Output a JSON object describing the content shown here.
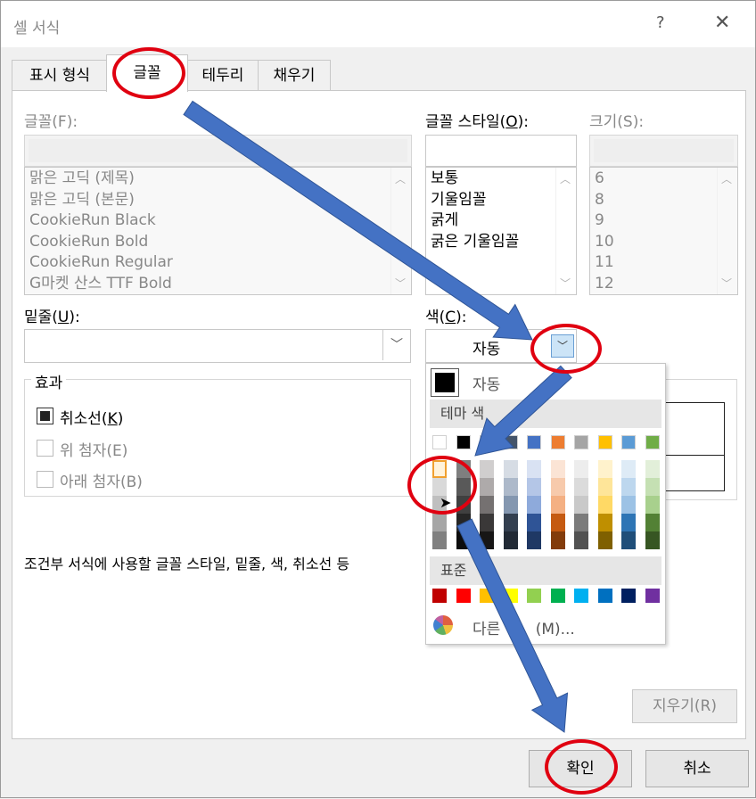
{
  "window": {
    "title": "셀 서식",
    "help": "?",
    "close": "✕"
  },
  "tabs": [
    {
      "label": "표시 형식"
    },
    {
      "label": "글꼴"
    },
    {
      "label": "테두리"
    },
    {
      "label": "채우기"
    }
  ],
  "font": {
    "label": "글꼴(F):",
    "items": [
      "맑은 고딕 (제목)",
      "맑은 고딕 (본문)",
      "CookieRun Black",
      "CookieRun Bold",
      "CookieRun Regular",
      "G마켓 산스 TTF Bold"
    ]
  },
  "style": {
    "label_pre": "글꼴 스타일(",
    "label_key": "O",
    "label_post": "):",
    "items": [
      "보통",
      "기울임꼴",
      "굵게",
      "굵은 기울임꼴"
    ]
  },
  "size": {
    "label": "크기(S):",
    "items": [
      "6",
      "8",
      "9",
      "10",
      "11",
      "12"
    ]
  },
  "underline": {
    "label_pre": "밑줄(",
    "label_key": "U",
    "label_post": "):",
    "value": ""
  },
  "color": {
    "label_pre": "색(",
    "label_key": "C",
    "label_post": "):",
    "value": "자동"
  },
  "effects": {
    "title": "효과",
    "strike_pre": "취소선(",
    "strike_key": "K",
    "strike_post": ")",
    "superscript": "위 첨자(E)",
    "subscript": "아래 첨자(B)"
  },
  "info_text": "조건부 서식에 사용할 글꼴 스타일, 밑줄, 색, 취소선 등",
  "buttons": {
    "clear": "지우기(R)",
    "ok": "확인",
    "cancel": "취소"
  },
  "palette": {
    "auto_label": "자동",
    "theme_header": "테마 색",
    "standard_header": "표준",
    "more_pre": "다른 ",
    "more_post": "(M)...",
    "theme_top": [
      "#ffffff",
      "#000000",
      "#44546a",
      "#44546a",
      "#4472c4",
      "#ed7d31",
      "#a5a5a5",
      "#ffc000",
      "#5b9bd5",
      "#70ad47"
    ],
    "theme_shades": [
      [
        "#f2f2f2",
        "#d9d9d9",
        "#bfbfbf",
        "#a6a6a6",
        "#808080"
      ],
      [
        "#7f7f7f",
        "#595959",
        "#404040",
        "#262626",
        "#0d0d0d"
      ],
      [
        "#d0cece",
        "#aeaaaa",
        "#757171",
        "#3a3838",
        "#171616"
      ],
      [
        "#d6dce4",
        "#adb9ca",
        "#8497b0",
        "#333f4f",
        "#222a35"
      ],
      [
        "#d9e2f3",
        "#b4c6e7",
        "#8eaadb",
        "#2f5496",
        "#1f3864"
      ],
      [
        "#fbe4d5",
        "#f7caac",
        "#f4b083",
        "#c55a11",
        "#833c0b"
      ],
      [
        "#ededed",
        "#dbdbdb",
        "#c9c9c9",
        "#7b7b7b",
        "#525252"
      ],
      [
        "#fff2cc",
        "#fee599",
        "#ffd965",
        "#bf8f00",
        "#7f6000"
      ],
      [
        "#deebf6",
        "#bdd7ee",
        "#9cc2e5",
        "#2e75b5",
        "#1f4e79"
      ],
      [
        "#e2efd9",
        "#c5e0b3",
        "#a8d08d",
        "#538135",
        "#375623"
      ]
    ],
    "standard": [
      "#c00000",
      "#ff0000",
      "#ffc000",
      "#ffff00",
      "#92d050",
      "#00b050",
      "#00b0f0",
      "#0070c0",
      "#002060",
      "#7030a0"
    ],
    "highlight_color": "#f0a030"
  },
  "annotation_color": "#e00010",
  "arrow_color": "#4472c4"
}
